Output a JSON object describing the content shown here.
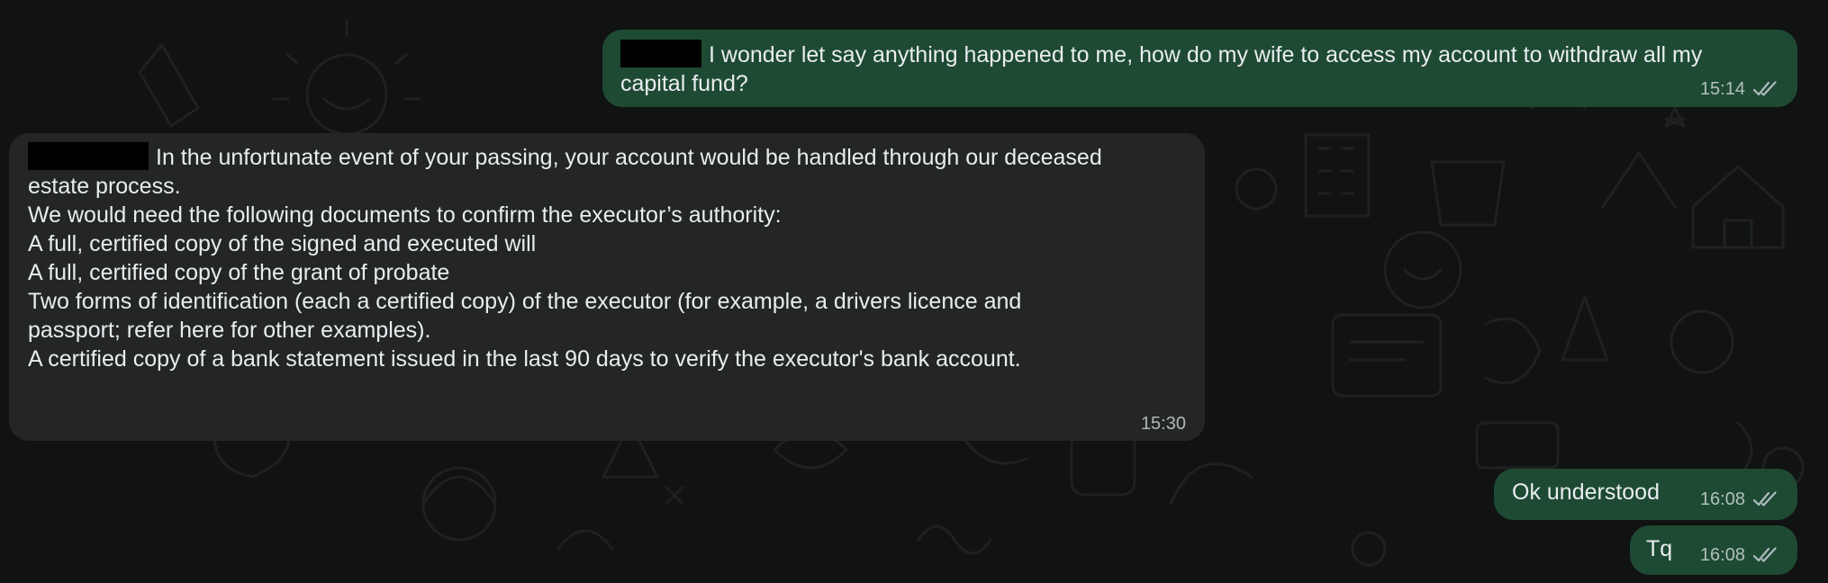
{
  "messages": [
    {
      "direction": "outgoing",
      "lines": [
        "I wonder let say anything happened to me, how do my wife to access my account to withdraw all my",
        "capital fund?"
      ],
      "time": "15:14",
      "status_icon": "double-check-icon"
    },
    {
      "direction": "incoming",
      "lines": [
        "In the unfortunate event of your passing, your account would be handled through our deceased",
        "estate process.",
        "We would need the following documents to confirm the executor’s authority:",
        "",
        "A full, certified copy of the signed and executed will",
        "A full, certified copy of the grant of probate",
        "Two forms of identification (each a certified copy) of the executor (for example, a drivers licence and",
        "passport; refer here for other examples).",
        "A certified copy of a bank statement issued in the last 90 days to verify the executor's bank account."
      ],
      "time": "15:30"
    },
    {
      "direction": "outgoing",
      "lines": [
        "Ok understood"
      ],
      "time": "16:08",
      "status_icon": "double-check-icon"
    },
    {
      "direction": "outgoing",
      "lines": [
        "Tq"
      ],
      "time": "16:08",
      "status_icon": "double-check-icon"
    }
  ],
  "colors": {
    "outgoing_bubble": "#1e4a34",
    "incoming_bubble": "#242626",
    "background": "#111212",
    "text": "#e9edef"
  }
}
